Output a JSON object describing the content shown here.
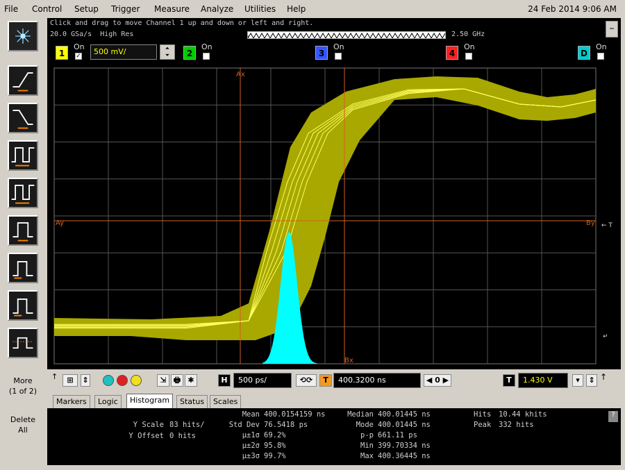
{
  "menu": {
    "items": [
      "File",
      "Control",
      "Setup",
      "Trigger",
      "Measure",
      "Analyze",
      "Utilities",
      "Help"
    ],
    "datetime": "24 Feb 2014  9:06 AM"
  },
  "info": {
    "hint": "Click and drag to move Channel 1 up and down or left and right.",
    "sample_rate": "20.0 GSa/s",
    "mode": "High Res",
    "bandwidth": "2.50 GHz"
  },
  "channels": [
    {
      "num": "1",
      "state": "On",
      "checked": "✓",
      "scale": "500 mV/",
      "color": "#ffff00"
    },
    {
      "num": "2",
      "state": "On",
      "checked": "",
      "color": "#00cc00"
    },
    {
      "num": "3",
      "state": "On",
      "checked": "",
      "color": "#3355ff"
    },
    {
      "num": "4",
      "state": "On",
      "checked": "",
      "color": "#ff2020"
    },
    {
      "num": "D",
      "state": "On",
      "checked": "",
      "color": "#00cccc"
    }
  ],
  "screen": {
    "marker_ax": "Ax",
    "marker_ay": "Ay",
    "marker_bx": "Bx",
    "marker_by": "By",
    "trigger_mark": "T",
    "colors": {
      "waveform": "#a8a800",
      "trace": "#ffff60",
      "histogram": "#00ffff",
      "grid": "#555555",
      "marker": "#d06020"
    }
  },
  "left": {
    "more_label": "More",
    "more_sub": "(1 of 2)",
    "delete_label": "Delete",
    "delete_sub": "All"
  },
  "controls": {
    "h_label": "H",
    "timebase": "500 ps/",
    "position": "400.3200 ns",
    "t_label": "T",
    "trigger_level": "1.430 V",
    "trigger_edge": "↑",
    "trigger_level_marker": "1"
  },
  "tabs": [
    "Markers",
    "Logic",
    "Histogram",
    "Status",
    "Scales"
  ],
  "measurements": {
    "y_scale_label": "Y Scale",
    "y_scale_value": "83 hits/",
    "y_offset_label": "Y Offset",
    "y_offset_value": "0 hits",
    "mean_label": "Mean",
    "mean_value": "400.0154159 ns",
    "stddev_label": "Std Dev",
    "stddev_value": "76.5418 ps",
    "s1_label": "μ±1σ",
    "s1_value": "69.2%",
    "s2_label": "μ±2σ",
    "s2_value": "95.8%",
    "s3_label": "μ±3σ",
    "s3_value": "99.7%",
    "median_label": "Median",
    "median_value": "400.01445 ns",
    "mode_label": "Mode",
    "mode_value": "400.01445 ns",
    "pp_label": "p-p",
    "pp_value": "661.11 ps",
    "min_label": "Min",
    "min_value": "399.70334 ns",
    "max_label": "Max",
    "max_value": "400.36445 ns",
    "hits_label": "Hits",
    "hits_value": "10.44 khits",
    "peak_label": "Peak",
    "peak_value": "332 hits",
    "help": "?"
  }
}
